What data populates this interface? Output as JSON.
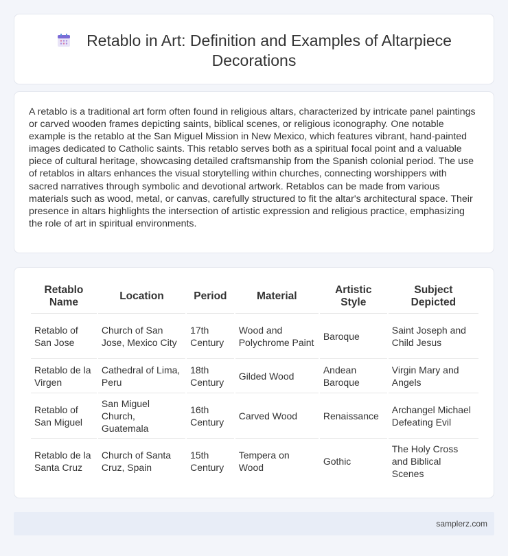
{
  "header": {
    "title": "Retablo in Art: Definition and Examples of Altarpiece Decorations",
    "icon": "calendar-icon"
  },
  "intro": {
    "text": "A retablo is a traditional art form often found in religious altars, characterized by intricate panel paintings or carved wooden frames depicting saints, biblical scenes, or religious iconography. One notable example is the retablo at the San Miguel Mission in New Mexico, which features vibrant, hand-painted images dedicated to Catholic saints. This retablo serves both as a spiritual focal point and a valuable piece of cultural heritage, showcasing detailed craftsmanship from the Spanish colonial period. The use of retablos in altars enhances the visual storytelling within churches, connecting worshippers with sacred narratives through symbolic and devotional artwork. Retablos can be made from various materials such as wood, metal, or canvas, carefully structured to fit the altar's architectural space. Their presence in altars highlights the intersection of artistic expression and religious practice, emphasizing the role of art in spiritual environments."
  },
  "table": {
    "headers": [
      "Retablo Name",
      "Location",
      "Period",
      "Material",
      "Artistic Style",
      "Subject Depicted"
    ],
    "rows": [
      [
        "Retablo of San Jose",
        "Church of San Jose, Mexico City",
        "17th Century",
        "Wood and Polychrome Paint",
        "Baroque",
        "Saint Joseph and Child Jesus"
      ],
      [
        "Retablo de la Virgen",
        "Cathedral of Lima, Peru",
        "18th Century",
        "Gilded Wood",
        "Andean Baroque",
        "Virgin Mary and Angels"
      ],
      [
        "Retablo of San Miguel",
        "San Miguel Church, Guatemala",
        "16th Century",
        "Carved Wood",
        "Renaissance",
        "Archangel Michael Defeating Evil"
      ],
      [
        "Retablo de la Santa Cruz",
        "Church of Santa Cruz, Spain",
        "15th Century",
        "Tempera on Wood",
        "Gothic",
        "The Holy Cross and Biblical Scenes"
      ]
    ]
  },
  "footer": {
    "site": "samplerz.com"
  }
}
